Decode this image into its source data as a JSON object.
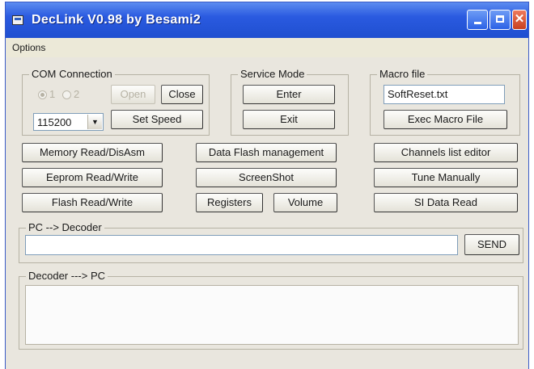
{
  "window": {
    "title": "DecLink V0.98  by Besami2"
  },
  "menu": {
    "options_label": "Options"
  },
  "com_connection": {
    "group_label": "COM Connection",
    "radio_1_label": "1",
    "radio_2_label": "2",
    "selected_port": "1",
    "open_label": "Open",
    "close_label": "Close",
    "baud_rate": "115200",
    "set_speed_label": "Set Speed"
  },
  "service_mode": {
    "group_label": "Service Mode",
    "enter_label": "Enter",
    "exit_label": "Exit"
  },
  "macro_file": {
    "group_label": "Macro file",
    "filename": "SoftReset.txt",
    "exec_label": "Exec Macro File"
  },
  "buttons": {
    "memory_read": "Memory Read/DisAsm",
    "data_flash": "Data Flash management",
    "channels_editor": "Channels list editor",
    "eeprom_rw": "Eeprom Read/Write",
    "screenshot": "ScreenShot",
    "tune_manually": "Tune Manually",
    "flash_rw": "Flash Read/Write",
    "registers": "Registers",
    "volume": "Volume",
    "si_data_read": "SI Data Read"
  },
  "pc_to_decoder": {
    "group_label": "PC --> Decoder",
    "input_value": "",
    "send_label": "SEND"
  },
  "decoder_to_pc": {
    "group_label": "Decoder ---> PC",
    "output_value": ""
  },
  "colors": {
    "titlebar": "#2a5ae0",
    "dialog_bg": "#e9e6de",
    "close_button": "#c8401f"
  }
}
